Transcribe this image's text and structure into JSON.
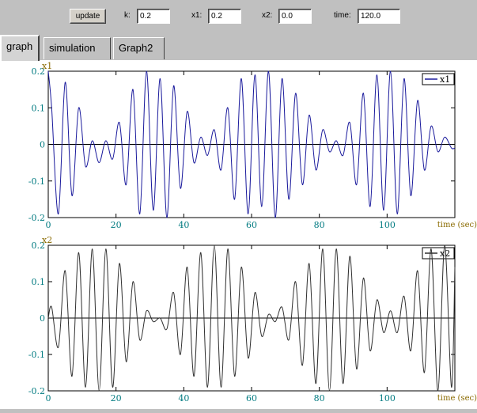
{
  "toolbar": {
    "update_label": "update",
    "k_label": "k:",
    "k_value": "0.2",
    "x1_label": "x1:",
    "x1_value": "0.2",
    "x2_label": "x2:",
    "x2_value": "0.0",
    "time_label": "time:",
    "time_value": "120.0"
  },
  "tabs": [
    "graph",
    "simulation",
    "Graph2"
  ],
  "colors": {
    "x1_line": "#1a1a9c",
    "x2_line": "#303030",
    "tick_text": "#007a80",
    "axis_title": "#8a6a00"
  },
  "chart_data": [
    {
      "type": "line",
      "ylabel": "x1",
      "xlabel": "time (sec)",
      "legend": "x1",
      "legend_position": "top-right",
      "xlim": [
        0,
        120
      ],
      "ylim": [
        -0.2,
        0.2
      ],
      "x_ticks": [
        "0",
        "20",
        "40",
        "60",
        "80",
        "100"
      ],
      "y_ticks": [
        "0.2",
        "0.1",
        "0",
        "-0.1",
        "-0.2"
      ],
      "series": [
        {
          "name": "x1",
          "x": [
            0,
            1,
            3,
            5,
            7,
            9,
            11,
            13,
            15,
            17,
            19,
            21,
            23,
            25,
            27,
            29,
            31,
            33,
            35,
            37,
            39,
            41,
            43,
            45,
            47,
            49,
            51,
            53,
            55,
            57,
            59,
            61,
            63,
            65,
            67,
            69,
            71,
            73,
            75,
            77,
            79,
            81,
            83,
            85,
            87,
            89,
            91,
            93,
            95,
            97,
            99,
            101,
            103,
            105,
            107,
            109,
            111,
            113,
            115,
            117,
            119,
            120
          ],
          "y": [
            0.2,
            0.1,
            -0.19,
            0.17,
            -0.14,
            0.1,
            -0.06,
            0.01,
            -0.05,
            0.01,
            -0.04,
            0.06,
            -0.11,
            0.15,
            -0.19,
            0.2,
            -0.18,
            0.18,
            -0.2,
            0.16,
            -0.12,
            0.09,
            -0.05,
            0.02,
            -0.03,
            0.04,
            -0.07,
            0.1,
            -0.15,
            0.18,
            -0.19,
            0.19,
            -0.17,
            0.2,
            -0.2,
            0.18,
            -0.15,
            0.14,
            -0.11,
            0.08,
            -0.07,
            0.04,
            -0.02,
            0.01,
            -0.03,
            0.06,
            -0.11,
            0.14,
            -0.17,
            0.19,
            -0.18,
            0.2,
            -0.19,
            0.18,
            -0.14,
            0.12,
            -0.07,
            0.05,
            -0.02,
            0.02,
            -0.01,
            -0.01
          ]
        }
      ]
    },
    {
      "type": "line",
      "ylabel": "x2",
      "xlabel": "time (sec)",
      "legend": "x2",
      "legend_position": "top-right",
      "xlim": [
        0,
        120
      ],
      "ylim": [
        -0.2,
        0.2
      ],
      "x_ticks": [
        "0",
        "20",
        "40",
        "60",
        "80",
        "100"
      ],
      "y_ticks": [
        "0.2",
        "0.1",
        "0",
        "-0.1",
        "-0.2"
      ],
      "series": [
        {
          "name": "x2",
          "x": [
            0,
            1,
            3,
            5,
            7,
            9,
            11,
            13,
            15,
            17,
            19,
            21,
            23,
            25,
            27,
            29,
            31,
            33,
            35,
            37,
            39,
            41,
            43,
            45,
            47,
            49,
            51,
            53,
            55,
            57,
            59,
            61,
            63,
            65,
            67,
            69,
            71,
            73,
            75,
            77,
            79,
            81,
            83,
            85,
            87,
            89,
            91,
            93,
            95,
            97,
            99,
            101,
            103,
            105,
            107,
            109,
            111,
            113,
            115,
            117,
            119,
            120
          ],
          "y": [
            0.0,
            0.03,
            -0.08,
            0.13,
            -0.16,
            0.18,
            -0.19,
            0.19,
            -0.2,
            0.19,
            -0.19,
            0.15,
            -0.12,
            0.1,
            -0.06,
            0.02,
            -0.01,
            0.0,
            -0.03,
            0.07,
            -0.1,
            0.14,
            -0.16,
            0.18,
            -0.19,
            0.2,
            -0.19,
            0.19,
            -0.16,
            0.14,
            -0.11,
            0.07,
            -0.05,
            0.01,
            -0.01,
            0.03,
            -0.06,
            0.1,
            -0.13,
            0.15,
            -0.18,
            0.19,
            -0.2,
            0.19,
            -0.18,
            0.17,
            -0.14,
            0.11,
            -0.09,
            0.05,
            -0.04,
            0.02,
            -0.04,
            0.06,
            -0.09,
            0.13,
            -0.15,
            0.19,
            -0.2,
            0.2,
            -0.19,
            0.14
          ]
        }
      ]
    }
  ]
}
